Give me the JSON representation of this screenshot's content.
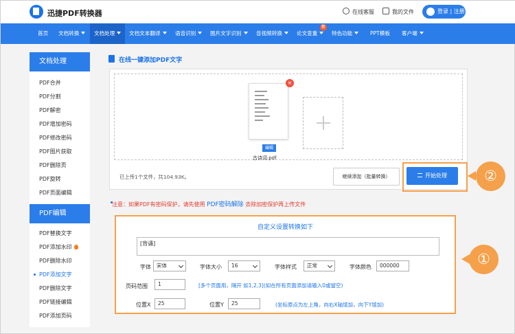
{
  "header": {
    "brand": "迅捷PDF转换器",
    "service": "在线客服",
    "myfiles": "我的文件",
    "login": "登录 | 注册"
  },
  "nav": {
    "items": [
      "首页",
      "文档转换",
      "文档处理",
      "文档文本翻译",
      "语音识别",
      "图片文字识别",
      "音视频转换",
      "论文查重",
      "特色功能",
      "PPT模板",
      "客户端"
    ],
    "new_badge": "新"
  },
  "sidebar": {
    "section1": "文档处理",
    "items1": [
      "PDF合并",
      "PDF分割",
      "PDF解密",
      "PDF增加密码",
      "PDF修改密码",
      "PDF图片获取",
      "PDF删除页",
      "PDF旋转",
      "PDF页面编辑"
    ],
    "section2": "PDF编辑",
    "items2": [
      "PDF替换文字",
      "PDF添加水印",
      "PDF删除水印",
      "PDF添加文字",
      "PDF删除文字",
      "PDF链接编辑",
      "PDF添加页码"
    ]
  },
  "main": {
    "title": "在线一键添加PDF文字",
    "edit": "编辑",
    "filename": "古诗词.pdf",
    "upload_status": "已上传1个文件，共104.93K。",
    "continue_btn": "继续添加（批量转换）",
    "start_btn": "开始处理",
    "note_prefix": "注意：如果PDF有密码保护，请先使用",
    "note_link": "PDF密码解除",
    "note_suffix": "去除加密保护再上传文件"
  },
  "settings": {
    "title": "自定义设置转换如下",
    "text_value": "[背诵]",
    "font_label": "字体",
    "font_value": "宋体",
    "size_label": "字体大小",
    "size_value": "16",
    "style_label": "字体样式",
    "style_value": "正常",
    "color_label": "字体颜色",
    "color_value": "000000",
    "page_label": "页码范围",
    "page_value": "1",
    "page_hint": "[多个页面用，隔开 如1,2,3](如在所有页面添加请输入0或留空)",
    "posx_label": "位置X",
    "posx_value": "25",
    "posy_label": "位置Y",
    "posy_value": "25",
    "pos_hint": "(坐标原点为左上角，向右X轴增加，向下Y增加)"
  },
  "callouts": {
    "one": "①",
    "two": "②"
  },
  "colors": {
    "primary": "#2b7de9",
    "highlight": "#f5a04a",
    "warning": "#e63a2e"
  }
}
